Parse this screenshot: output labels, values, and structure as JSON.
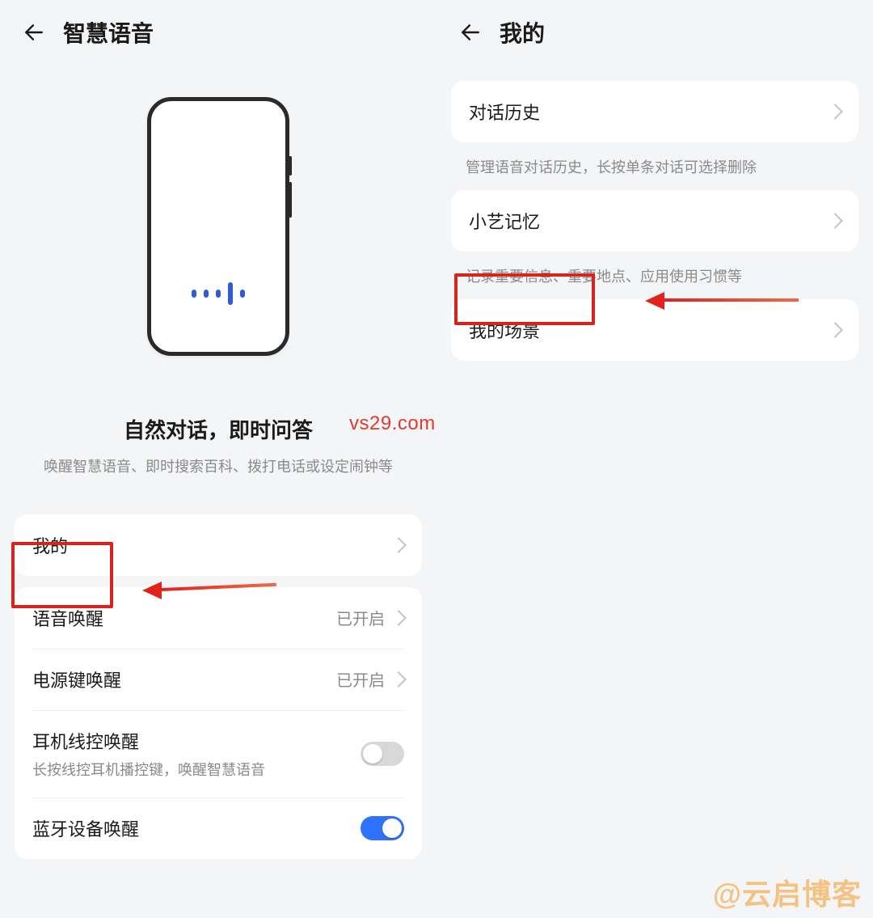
{
  "left": {
    "title": "智慧语音",
    "hero_title": "自然对话，即时问答",
    "hero_desc": "唤醒智慧语音、即时搜索百科、拨打电话或设定闹钟等",
    "my": {
      "label": "我的"
    },
    "wake": {
      "voice": {
        "label": "语音唤醒",
        "value": "已开启"
      },
      "power": {
        "label": "电源键唤醒",
        "value": "已开启"
      },
      "wired": {
        "label": "耳机线控唤醒",
        "sub": "长按线控耳机播控键，唤醒智慧语音",
        "on": false
      },
      "bluetooth": {
        "label": "蓝牙设备唤醒",
        "on": true
      }
    }
  },
  "right": {
    "title": "我的",
    "history": {
      "label": "对话历史",
      "desc": "管理语音对话历史，长按单条对话可选择删除"
    },
    "memory": {
      "label": "小艺记忆",
      "desc": "记录重要信息、重要地点、应用使用习惯等"
    },
    "scenes": {
      "label": "我的场景"
    }
  },
  "watermarks": {
    "site": "vs29.com",
    "author": "@云启博客"
  }
}
